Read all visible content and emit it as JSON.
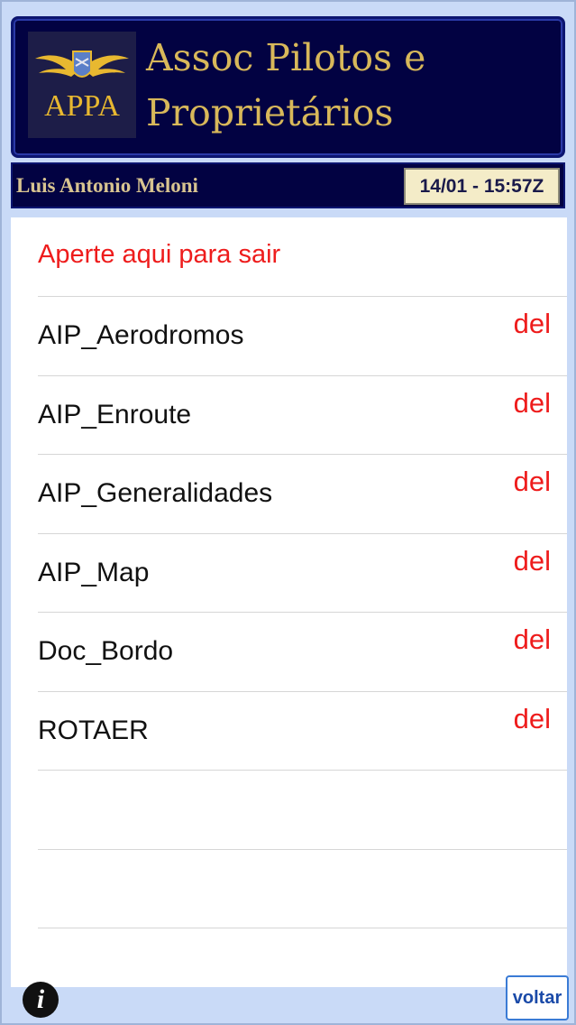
{
  "header": {
    "logo_text": "APPA",
    "title_line1": "Assoc Pilotos e",
    "title_line2": "Proprietários"
  },
  "userbar": {
    "username": "Luis Antonio Meloni",
    "timestamp": "14/01 - 15:57Z"
  },
  "list": {
    "exit_label": "Aperte aqui para sair",
    "delete_label": "del",
    "items": [
      {
        "label": "AIP_Aerodromos"
      },
      {
        "label": "AIP_Enroute"
      },
      {
        "label": "AIP_Generalidades"
      },
      {
        "label": "AIP_Map"
      },
      {
        "label": "Doc_Bordo"
      },
      {
        "label": "ROTAER"
      }
    ]
  },
  "footer": {
    "info_icon": "info-icon",
    "info_glyph": "i",
    "back_label": "voltar"
  },
  "colors": {
    "header_bg": "#020242",
    "accent_gold": "#d8b85a",
    "delete_red": "#ee1c1c"
  }
}
